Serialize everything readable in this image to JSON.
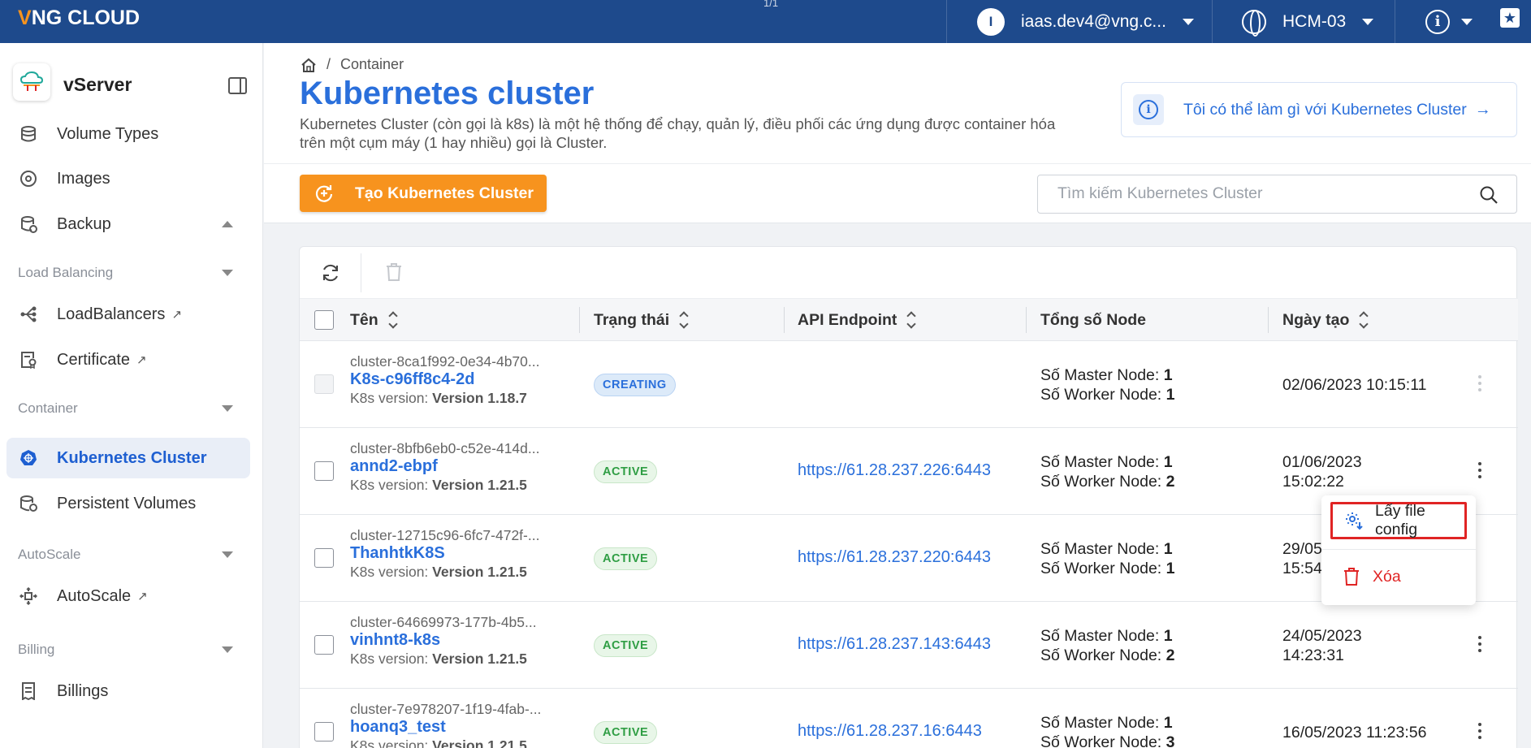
{
  "topbar": {
    "logo_prefix": "V",
    "logo_rest": "NG CLOUD",
    "page_indicator": "1/1",
    "user_initial": "I",
    "user_email": "iaas.dev4@vng.c...",
    "region": "HCM-03"
  },
  "sidebar": {
    "product": "vServer",
    "items": {
      "volume_types": "Volume Types",
      "images": "Images",
      "backup": "Backup",
      "loadbalancers": "LoadBalancers",
      "certificate": "Certificate",
      "kubernetes_cluster": "Kubernetes Cluster",
      "persistent_volumes": "Persistent Volumes",
      "autoscale": "AutoScale",
      "billings": "Billings"
    },
    "sections": {
      "load_balancing": "Load Balancing",
      "container": "Container",
      "autoscale": "AutoScale",
      "billing": "Billing"
    }
  },
  "header": {
    "breadcrumb_sep": "/",
    "breadcrumb_current": "Container",
    "title": "Kubernetes cluster",
    "description": "Kubernetes Cluster (còn gọi là k8s) là một hệ thống để chạy, quản lý, điều phối các ứng dụng được container hóa trên một cụm máy (1 hay nhiều) gọi là Cluster.",
    "help_text": "Tôi có thể làm gì với Kubernetes Cluster",
    "help_arrow": "→"
  },
  "toolbar": {
    "create_label": "Tạo Kubernetes Cluster",
    "search_placeholder": "Tìm kiếm Kubernetes Cluster"
  },
  "table": {
    "columns": {
      "name": "Tên",
      "status": "Trạng thái",
      "endpoint": "API Endpoint",
      "nodes": "Tổng số Node",
      "created": "Ngày tạo"
    },
    "labels": {
      "k8s_version": "K8s version:",
      "master_node": "Số Master Node:",
      "worker_node": "Số Worker Node:"
    },
    "rows": [
      {
        "id": "cluster-8ca1f992-0e34-4b70...",
        "name": "K8s-c96ff8c4-2d",
        "version": "Version 1.18.7",
        "status": "CREATING",
        "endpoint": "",
        "master": "1",
        "worker": "1",
        "date_line1": "02/06/2023 10:15:11",
        "date_line2": ""
      },
      {
        "id": "cluster-8bfb6eb0-c52e-414d...",
        "name": "annd2-ebpf",
        "version": "Version 1.21.5",
        "status": "ACTIVE",
        "endpoint": "https://61.28.237.226:6443",
        "master": "1",
        "worker": "2",
        "date_line1": "01/06/2023",
        "date_line2": "15:02:22"
      },
      {
        "id": "cluster-12715c96-6fc7-472f-...",
        "name": "ThanhtkK8S",
        "version": "Version 1.21.5",
        "status": "ACTIVE",
        "endpoint": "https://61.28.237.220:6443",
        "master": "1",
        "worker": "1",
        "date_line1": "29/05",
        "date_line2": "15:54"
      },
      {
        "id": "cluster-64669973-177b-4b5...",
        "name": "vinhnt8-k8s",
        "version": "Version 1.21.5",
        "status": "ACTIVE",
        "endpoint": "https://61.28.237.143:6443",
        "master": "1",
        "worker": "2",
        "date_line1": "24/05/2023",
        "date_line2": "14:23:31"
      },
      {
        "id": "cluster-7e978207-1f19-4fab-...",
        "name": "hoanq3_test",
        "version": "Version 1.21.5",
        "status": "ACTIVE",
        "endpoint": "https://61.28.237.16:6443",
        "master": "1",
        "worker": "3",
        "date_line1": "16/05/2023 11:23:56",
        "date_line2": ""
      }
    ]
  },
  "context_menu": {
    "get_config": "Lấy file config",
    "delete": "Xóa"
  },
  "colors": {
    "topbar": "#1e4a8c",
    "accent": "#2a6fdb",
    "orange": "#f7931e",
    "danger": "#e02424"
  }
}
